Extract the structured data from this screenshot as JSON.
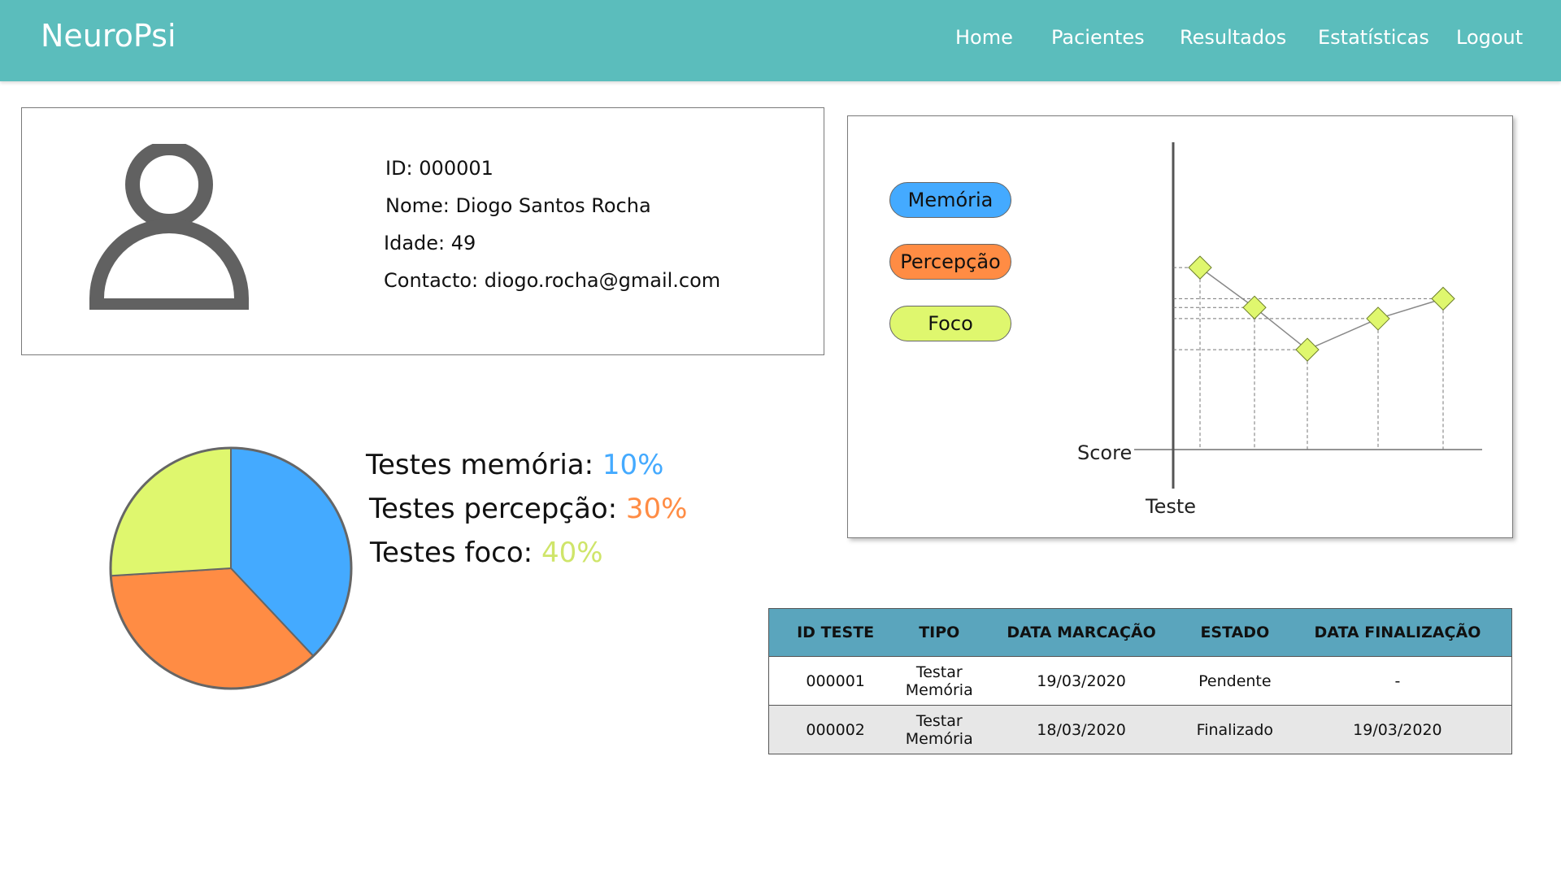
{
  "app": {
    "brand": "NeuroPsi"
  },
  "nav": [
    "Home",
    "Pacientes",
    "Resultados",
    "Estatísticas",
    "Logout"
  ],
  "patient": {
    "avatar_icon": "user-icon",
    "id_line": "ID: 000001",
    "name_line": "Nome: Diogo Santos Rocha",
    "age_line": "Idade: 49",
    "contact_line": "Contacto: diogo.rocha@gmail.com"
  },
  "stats": {
    "memoria_label": "Testes memória: ",
    "memoria_value": "10%",
    "percepcao_label": "Testes percepção: ",
    "percepcao_value": "30%",
    "foco_label": "Testes foco: ",
    "foco_value": "40%"
  },
  "colors": {
    "memoria": "#44aaff",
    "percepcao": "#ff8c44",
    "foco": "#dff76e",
    "accent": "#5bbdbc",
    "table_header": "#5aa5bd"
  },
  "chart_data": [
    {
      "type": "pie",
      "title": "",
      "slices": [
        {
          "label": "Memória",
          "value": 38,
          "color": "#44aaff"
        },
        {
          "label": "Percepção",
          "value": 36,
          "color": "#ff8c44"
        },
        {
          "label": "Foco",
          "value": 26,
          "color": "#dff76e"
        }
      ]
    },
    {
      "type": "line",
      "title": "",
      "xlabel": "Teste",
      "ylabel": "Score",
      "legend": [
        "Memória",
        "Percepção",
        "Foco"
      ],
      "legend_placement": "left",
      "grid": false,
      "series": [
        {
          "name": "Foco",
          "x": [
            1,
            2,
            3,
            4,
            5
          ],
          "values": [
            0.82,
            0.64,
            0.45,
            0.59,
            0.68
          ]
        }
      ]
    }
  ],
  "table": {
    "headers": [
      "ID TESTE",
      "TIPO",
      "DATA MARCAÇÃO",
      "ESTADO",
      "DATA FINALIZAÇÃO"
    ],
    "rows": [
      [
        "000001",
        "Testar Memória",
        "19/03/2020",
        "Pendente",
        "-"
      ],
      [
        "000002",
        "Testar Memória",
        "18/03/2020",
        "Finalizado",
        "19/03/2020"
      ]
    ]
  }
}
